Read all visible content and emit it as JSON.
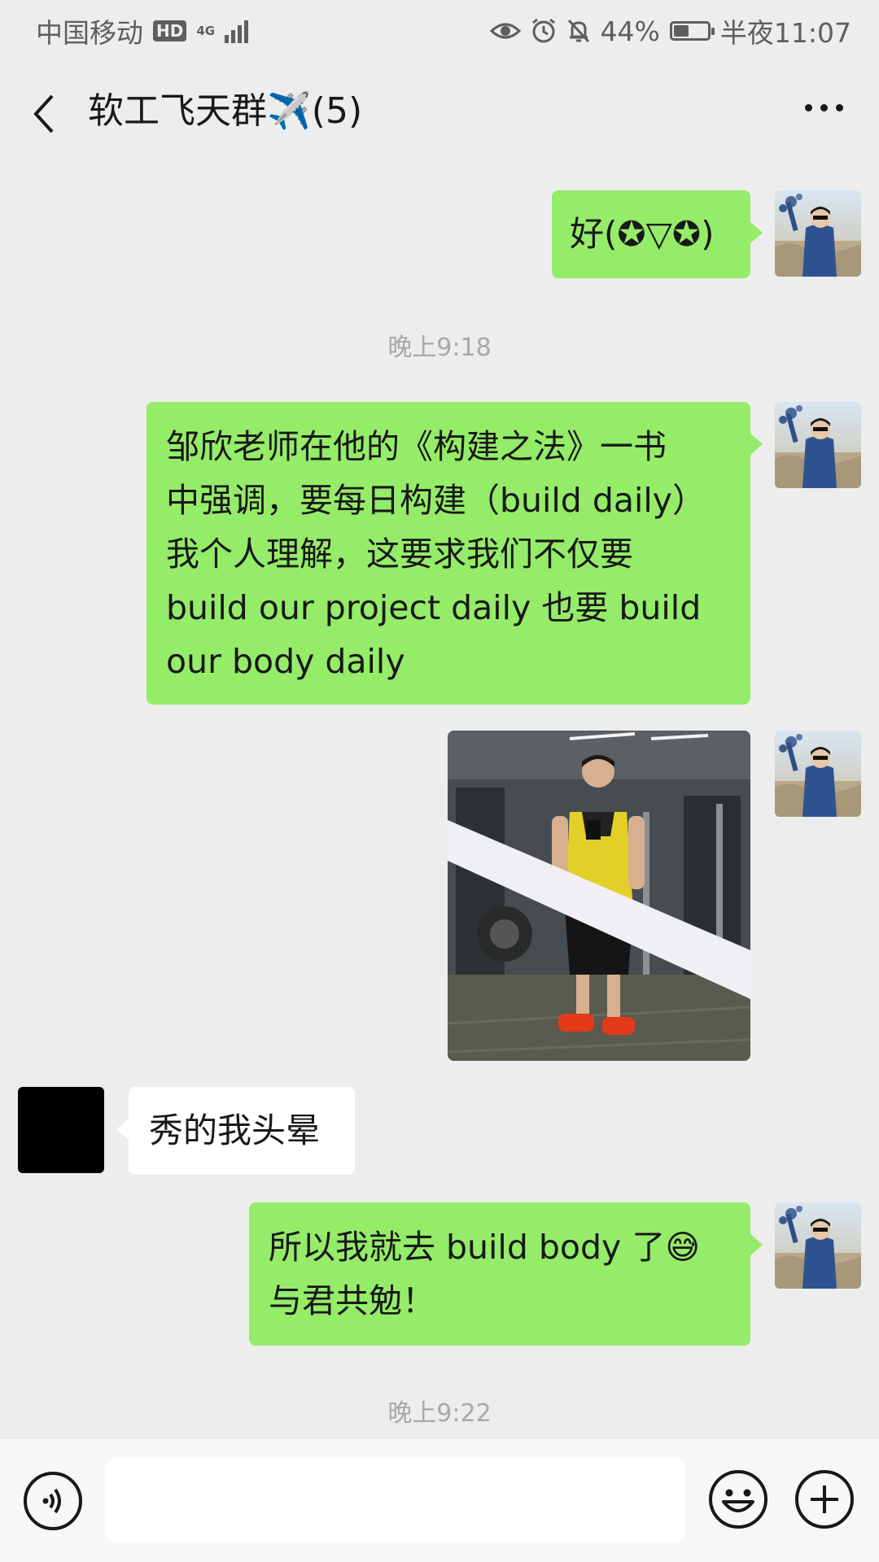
{
  "status_bar": {
    "carrier": "中国移动",
    "hd_badge": "HD",
    "network": "4G",
    "battery": "44%",
    "battery_level": 0.44,
    "time": "半夜11:07"
  },
  "header": {
    "title": "软工飞天群✈️(5)"
  },
  "messages": [
    {
      "sender": "me",
      "type": "text",
      "text": "好(✪▽✪)"
    },
    {
      "type": "timestamp",
      "text": "晚上9:18"
    },
    {
      "sender": "me",
      "type": "text",
      "lines": [
        "邹欣老师在他的《构建之法》一书",
        "中强调，要每日构建（build daily）",
        "我个人理解，这要求我们不仅要",
        "build our project daily 也要 build",
        "our body daily"
      ]
    },
    {
      "sender": "me",
      "type": "image"
    },
    {
      "sender": "other",
      "type": "text",
      "text": "秀的我头晕"
    },
    {
      "sender": "me",
      "type": "text",
      "lines": [
        "所以我就去 build body 了😅",
        "与君共勉！"
      ]
    },
    {
      "type": "timestamp",
      "text": "晚上9:22"
    }
  ],
  "input_bar": {
    "placeholder": ""
  },
  "colors": {
    "my_bubble": "#95ec69",
    "other_bubble": "#ffffff",
    "background": "#ededed"
  },
  "icons": {
    "back": "chevron-left-icon",
    "more": "more-icon",
    "voice": "voice-icon",
    "emoji": "emoji-icon",
    "plus": "plus-icon"
  }
}
